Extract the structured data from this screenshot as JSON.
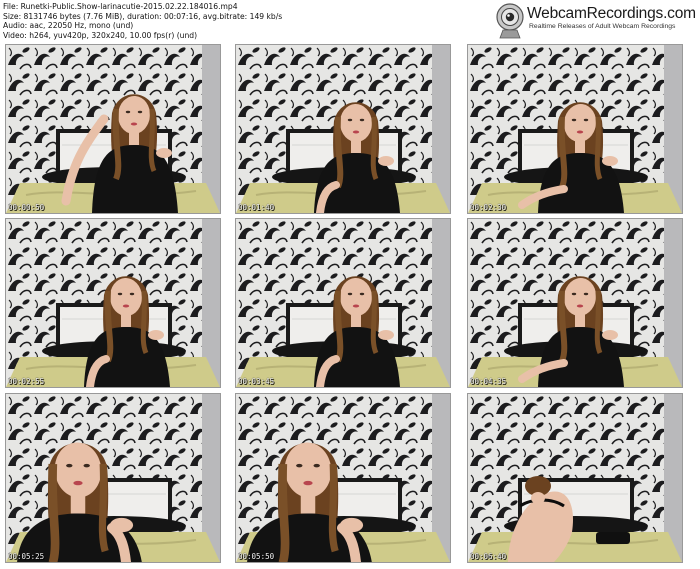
{
  "header": {
    "file": "File: Runetki-Public.Show-larinacutie-2015.02.22.184016.mp4",
    "size": "Size: 8131746 bytes (7.76 MiB), duration: 00:07:16, avg.bitrate: 149 kb/s",
    "audio": "Audio: aac, 22050 Hz, mono (und)",
    "video": "Video: h264, yuv420p, 320x240, 10.00 fps(r) (und)"
  },
  "logo": {
    "title": "WebcamRecordings.com",
    "tagline": "Realtime Releases of Adult Webcam Recordings",
    "icon": "webcam-icon"
  },
  "thumbnails": [
    {
      "time": "00:00:50",
      "pose": "hand-hair"
    },
    {
      "time": "00:01:40",
      "pose": "center"
    },
    {
      "time": "00:02:30",
      "pose": "right"
    },
    {
      "time": "00:02:55",
      "pose": "center"
    },
    {
      "time": "00:03:45",
      "pose": "center"
    },
    {
      "time": "00:04:35",
      "pose": "right"
    },
    {
      "time": "00:05:25",
      "pose": "close-left"
    },
    {
      "time": "00:05:50",
      "pose": "close-left"
    },
    {
      "time": "00:06:40",
      "pose": "back"
    }
  ],
  "colors": {
    "wallpaper": "#e6e6e4",
    "pattern": "#1c1c1e",
    "bed": "#cfcb8a",
    "headboard": "#efeeec",
    "skin": "#e8c0a8",
    "hair": "#6b4220"
  }
}
